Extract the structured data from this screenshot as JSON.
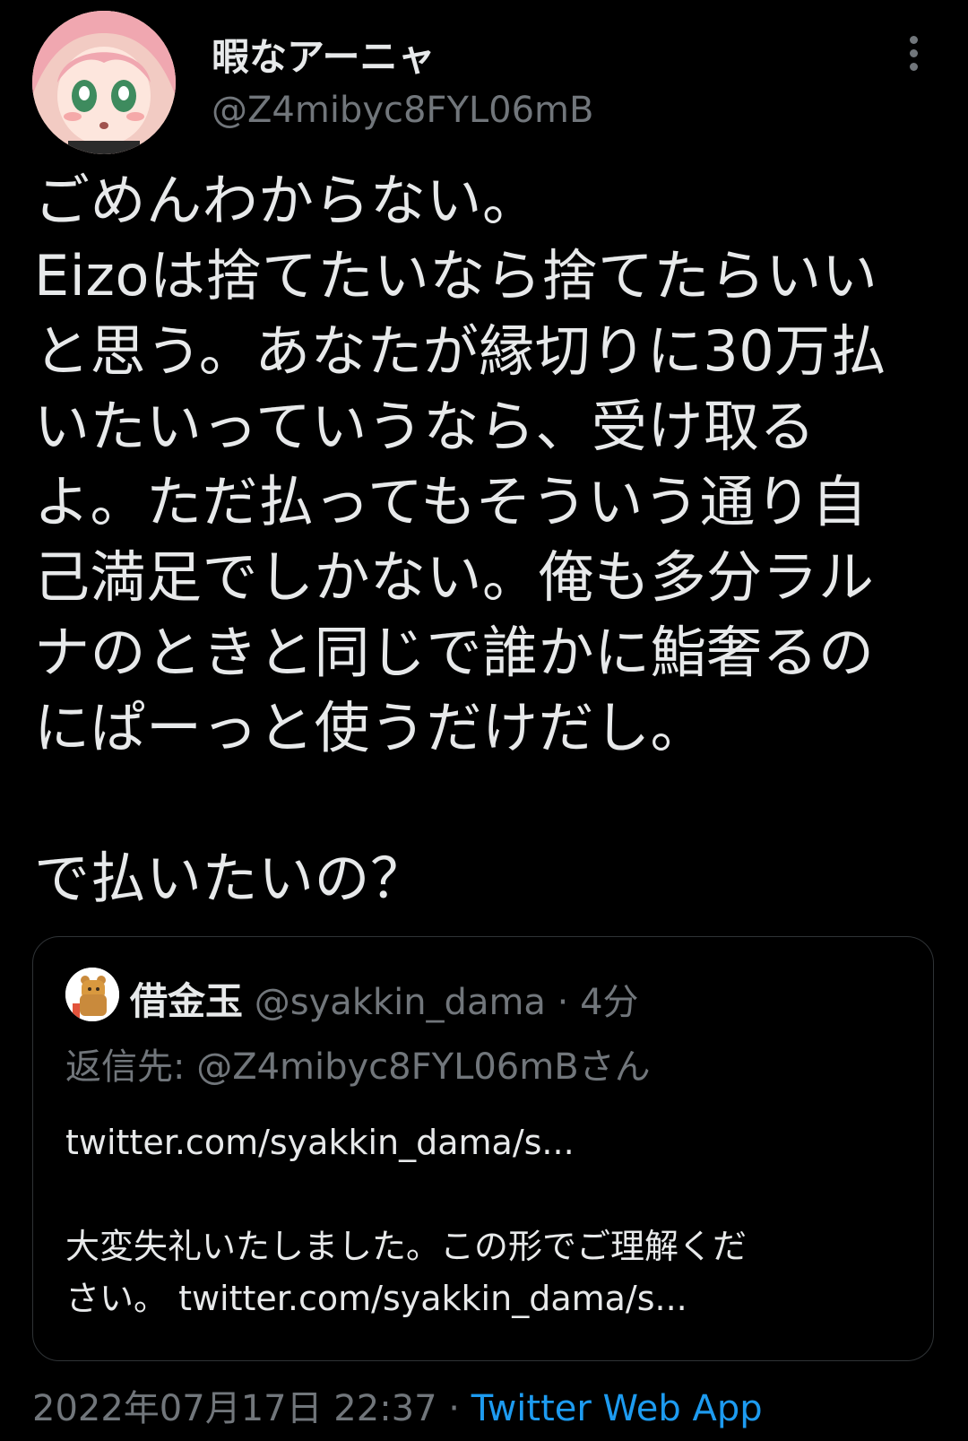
{
  "tweet": {
    "display_name": "暇なアーニャ",
    "handle": "@Z4mibyc8FYL06mB",
    "text": "ごめんわからない。\nEizoは捨てたいなら捨てたらいい\nと思う。あなたが縁切りに30万払\nいたいっていうなら、受け取る\nよ。ただ払ってもそういう通り自\n己満足でしかない。俺も多分ラル\nナのときと同じで誰かに鮨奢るの\nにぱーっと使うだけだし。\n\nで払いたいの？",
    "timestamp": "2022年07月17日 22:37",
    "separator": " · ",
    "source": "Twitter Web App"
  },
  "quote": {
    "name": "借金玉",
    "handle": "@syakkin_dama",
    "time": " · 4分",
    "reply_to": "返信先: @Z4mibyc8FYL06mBさん",
    "text": "twitter.com/syakkin_dama/s...\n\n大変失礼いたしました。この形でご理解くだ\nさい。 twitter.com/syakkin_dama/s..."
  },
  "icons": {
    "more": "more-vertical-icon",
    "avatar": "anime-avatar-icon",
    "quote_avatar": "bear-avatar-icon"
  },
  "colors": {
    "background": "#000000",
    "text": "#e7e9ea",
    "secondary": "#71767b",
    "link": "#1d9bf0",
    "border": "#2f3336"
  }
}
